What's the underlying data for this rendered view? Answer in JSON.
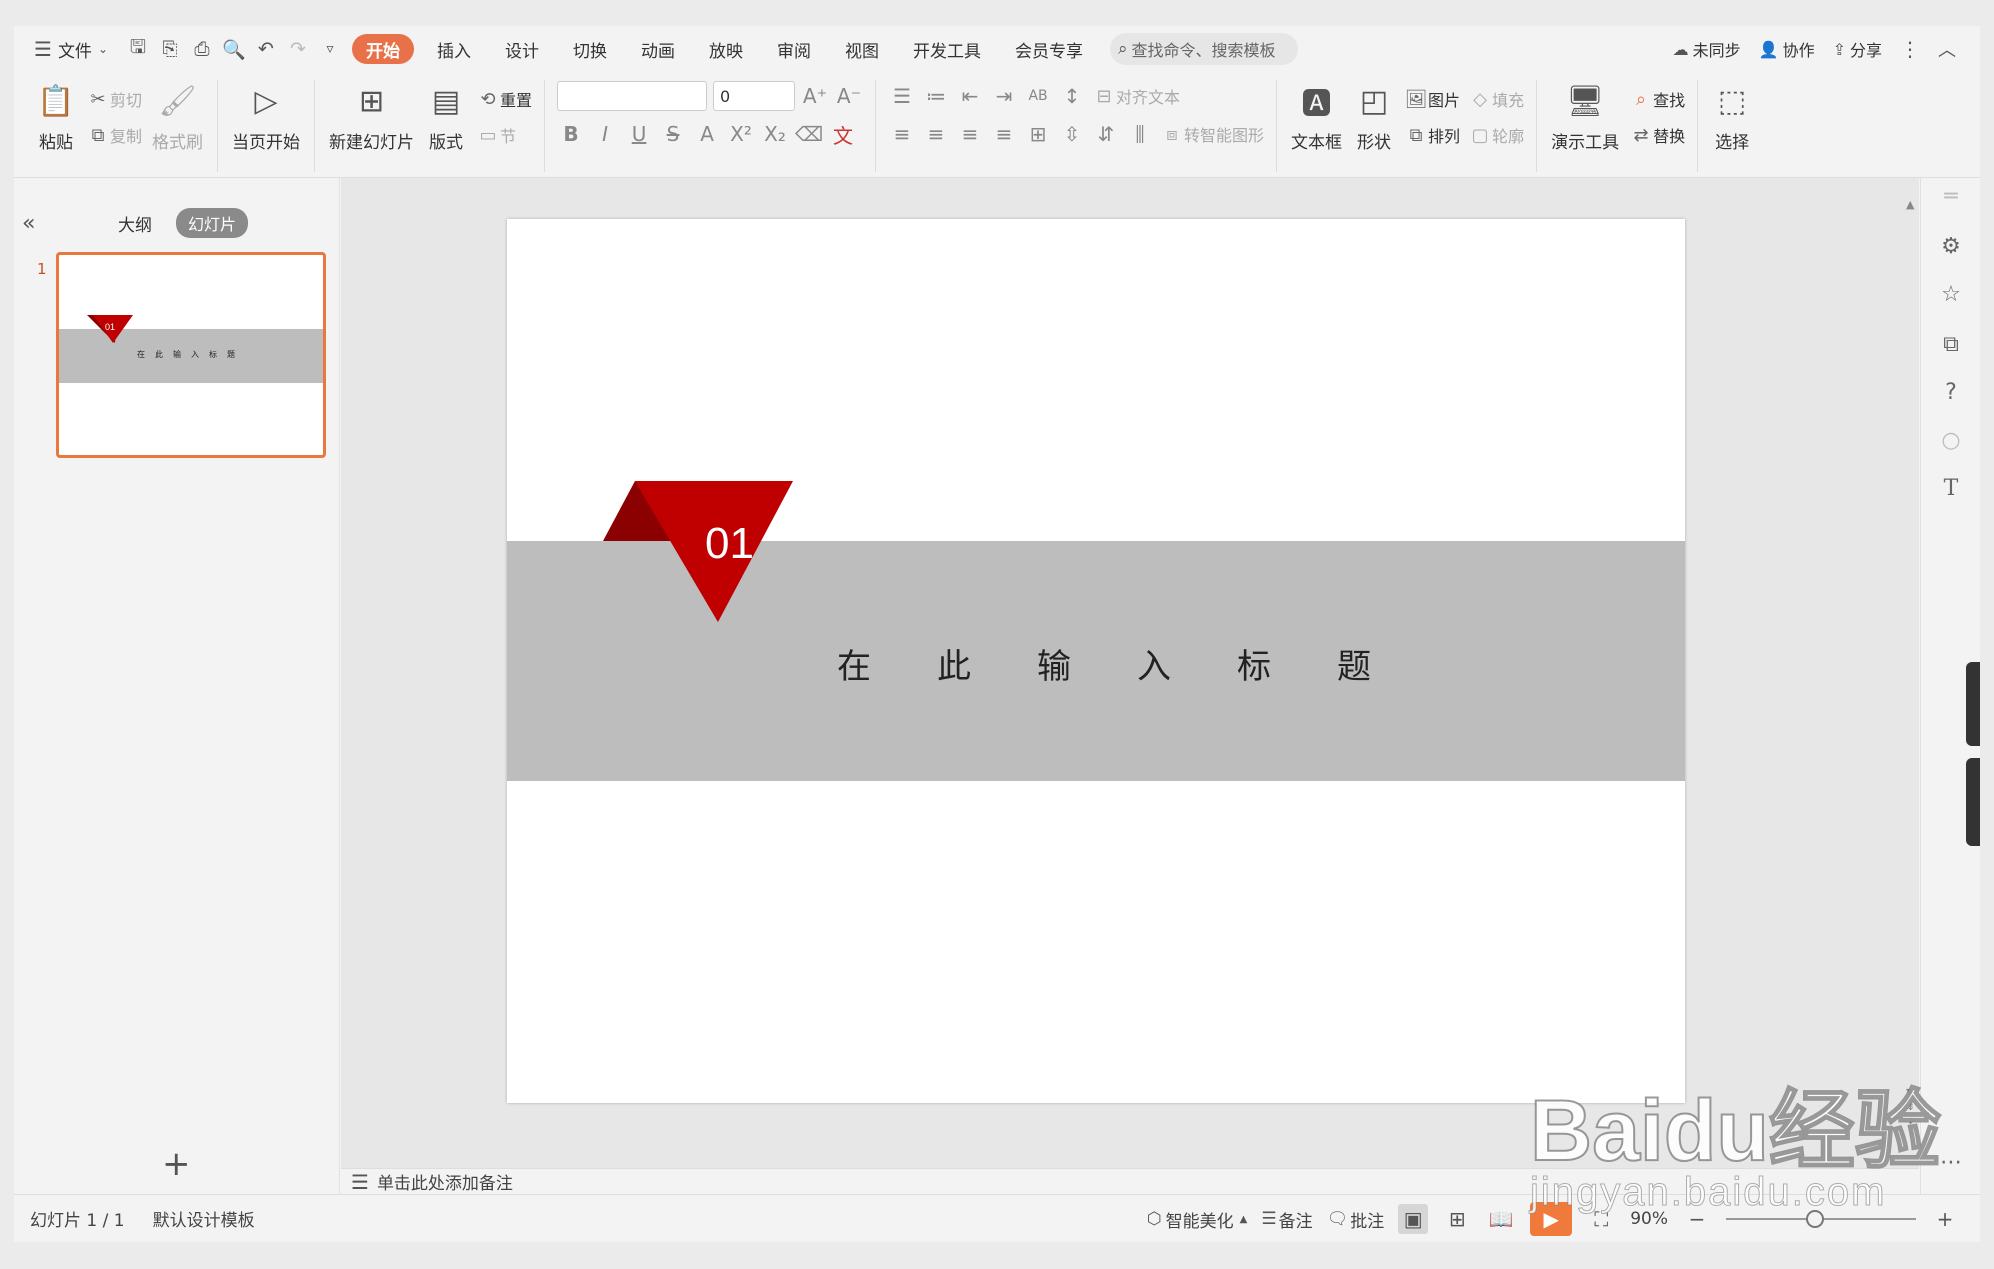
{
  "menubar": {
    "file_menu": "文件",
    "tabs": [
      "开始",
      "插入",
      "设计",
      "切换",
      "动画",
      "放映",
      "审阅",
      "视图",
      "开发工具",
      "会员专享"
    ],
    "search_placeholder": "查找命令、搜索模板",
    "sync": "未同步",
    "collab": "协作",
    "share": "分享"
  },
  "ribbon": {
    "paste": "粘贴",
    "cut": "剪切",
    "copy": "复制",
    "format_painter": "格式刷",
    "start_from_current": "当页开始",
    "new_slide": "新建幻灯片",
    "layout": "版式",
    "reset": "重置",
    "section": "节",
    "font_size": "0",
    "align_text": "对齐文本",
    "convert_smartart": "转智能图形",
    "textbox": "文本框",
    "shape": "形状",
    "picture": "图片",
    "fill": "填充",
    "arrange": "排列",
    "outline": "轮廓",
    "present_tools": "演示工具",
    "find": "查找",
    "replace": "替换",
    "select": "选择"
  },
  "leftpanel": {
    "tab_outline": "大纲",
    "tab_slides": "幻灯片",
    "slide_number": "1"
  },
  "slide": {
    "badge": "01",
    "title": "在此输入标题",
    "colors": {
      "accent_red": "#c00000",
      "accent_dark_red": "#8b0000",
      "band_gray": "#bdbdbd"
    }
  },
  "notes_placeholder": "单击此处添加备注",
  "statusbar": {
    "slide_counter": "幻灯片 1 / 1",
    "template": "默认设计模板",
    "smart_beautify": "智能美化",
    "notes": "备注",
    "comments": "批注",
    "zoom": "90%"
  },
  "watermark": {
    "text": "Baidu经验",
    "url": "jingyan.baidu.com"
  }
}
